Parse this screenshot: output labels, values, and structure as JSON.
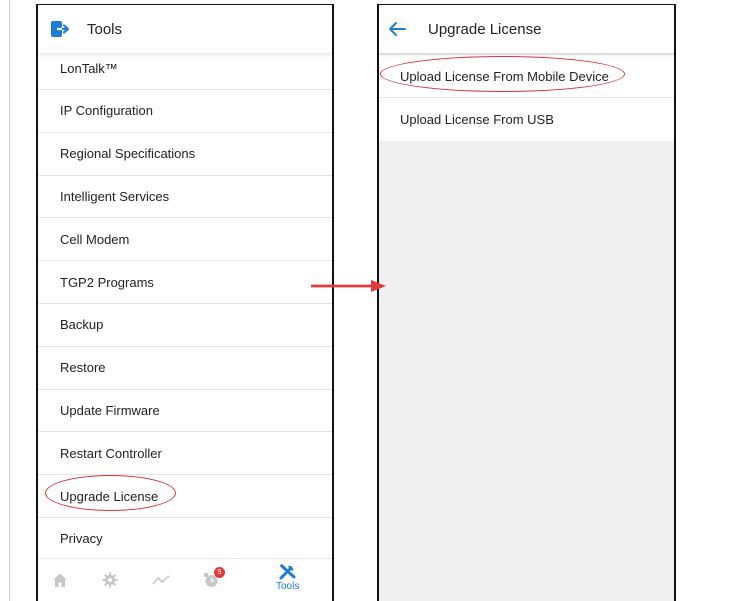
{
  "left_screen": {
    "title": "Tools",
    "menu_items": [
      "LonTalk™",
      "IP Configuration",
      "Regional Specifications",
      "Intelligent Services",
      "Cell Modem",
      "TGP2 Programs",
      "Backup",
      "Restore",
      "Update Firmware",
      "Restart Controller",
      "Upgrade License",
      "Privacy"
    ],
    "highlighted_item": "Upgrade License",
    "tab_bar": {
      "tabs": [
        {
          "icon": "home-icon"
        },
        {
          "icon": "gear-icon"
        },
        {
          "icon": "trend-icon"
        },
        {
          "icon": "alarm-clock-icon",
          "badge": "9"
        },
        {
          "icon": "tools-icon",
          "label": "Tools",
          "active": true
        }
      ],
      "active_color": "#1f7bd8",
      "inactive_color": "#c7c7c7"
    }
  },
  "right_screen": {
    "title": "Upgrade License",
    "options": [
      "Upload License From Mobile Device",
      "Upload License From USB"
    ],
    "highlighted_item": "Upload License From Mobile Device"
  },
  "annotation_color": "#d9333a",
  "accent_color": "#1f7bd8"
}
